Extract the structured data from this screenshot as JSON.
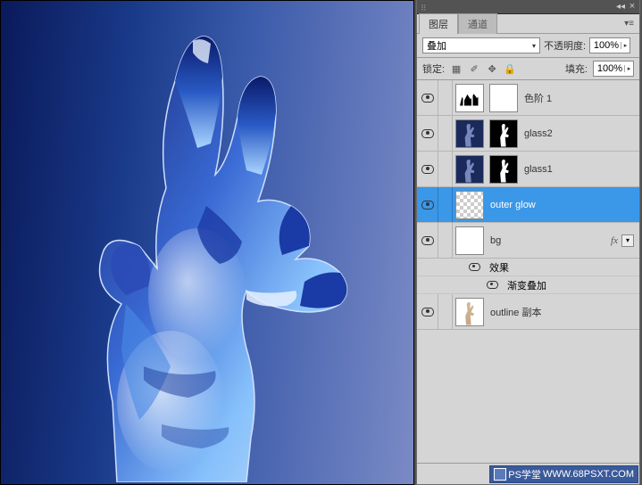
{
  "tabs": {
    "layers": "图层",
    "channels": "通道"
  },
  "blend": {
    "mode": "叠加",
    "opacity_label": "不透明度:",
    "opacity": "100%",
    "fill_label": "填充:",
    "fill": "100%",
    "lock_label": "锁定:"
  },
  "layers": [
    {
      "name": "色阶 1",
      "type": "levels",
      "visible": true
    },
    {
      "name": "glass2",
      "type": "glass",
      "visible": true
    },
    {
      "name": "glass1",
      "type": "glass",
      "visible": true
    },
    {
      "name": "outer glow",
      "type": "trans",
      "visible": true,
      "selected": true
    },
    {
      "name": "bg",
      "type": "white",
      "visible": true,
      "fx": true
    },
    {
      "name": "outline 副本",
      "type": "outline",
      "visible": true
    }
  ],
  "fx": {
    "effects_label": "效果",
    "gradient_overlay": "渐变叠加"
  },
  "watermark": {
    "brand": "PS学堂",
    "url": "WWW.68PSXT.COM"
  }
}
